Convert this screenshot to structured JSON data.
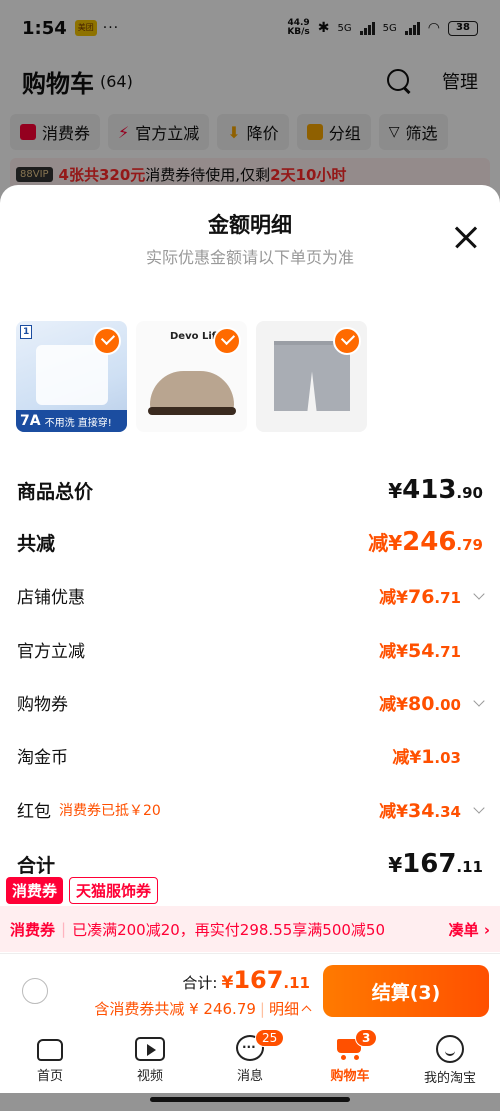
{
  "status_bar": {
    "time": "1:54",
    "app_badge": "美团",
    "dots": "···",
    "net_speed_value": "44.9",
    "net_speed_unit": "KB/s",
    "sig1": "5G",
    "sig2": "5G",
    "battery": "38"
  },
  "cart": {
    "title": "购物车",
    "count": "(64)",
    "manage": "管理",
    "filters": [
      {
        "label": "消费券",
        "color": "#ff0036"
      },
      {
        "label": "官方立减",
        "color": "#ff0036"
      },
      {
        "label": "降价",
        "color": "#f7a600"
      },
      {
        "label": "分组",
        "color": "#f7a600"
      },
      {
        "label": "筛选",
        "color": "#222222"
      }
    ],
    "promo": {
      "vip": "88VIP",
      "highlight1": "4张共320元",
      "middle": "消费券待使用,仅剩",
      "highlight2": "2天10小时"
    }
  },
  "sheet": {
    "title": "金额明细",
    "subtitle": "实际优惠金额请以下单页为准",
    "products": [
      {
        "tag": "1",
        "badge": "7A",
        "caption": "不用洗 直接穿!"
      },
      {
        "brand": "Devo Life"
      },
      {}
    ],
    "rows": {
      "total_price": {
        "label": "商品总价",
        "cur": "¥",
        "int": "413",
        "dec": ".90"
      },
      "total_discount": {
        "label": "共减",
        "cur": "减¥",
        "int": "246",
        "dec": ".79"
      },
      "shop_discount": {
        "label": "店铺优惠",
        "cur": "减¥",
        "int": "76",
        "dec": ".71"
      },
      "official_discount": {
        "label": "官方立减",
        "cur": "减¥",
        "int": "54",
        "dec": ".71"
      },
      "coupon": {
        "label": "购物券",
        "cur": "减¥",
        "int": "80",
        "dec": ".00"
      },
      "taojinbi": {
        "label": "淘金币",
        "cur": "减¥",
        "int": "1",
        "dec": ".03"
      },
      "red_packet": {
        "label": "红包",
        "note": "消费券已抵￥20",
        "cur": "减¥",
        "int": "34",
        "dec": ".34"
      },
      "sum": {
        "label": "合计",
        "cur": "¥",
        "int": "167",
        "dec": ".11"
      }
    }
  },
  "coupon_tags": {
    "tag1": "消费券",
    "tag2": "天猫服饰券"
  },
  "coupon_bar": {
    "lead": "消费券",
    "text": "已凑满200减20，再实付298.55享满500减50",
    "action": "凑单"
  },
  "checkout": {
    "total_label": "合计:",
    "cur": "¥",
    "int": "167",
    "dec": ".11",
    "discount_text": "含消费券共减 ¥ 246.79",
    "detail": "明细",
    "button": "结算(3)"
  },
  "tabbar": {
    "home": "首页",
    "video": "视频",
    "messages": "消息",
    "messages_badge": "25",
    "cart": "购物车",
    "cart_badge": "3",
    "me": "我的淘宝"
  },
  "colors": {
    "accent": "#ff5000",
    "red": "#ff0036"
  }
}
